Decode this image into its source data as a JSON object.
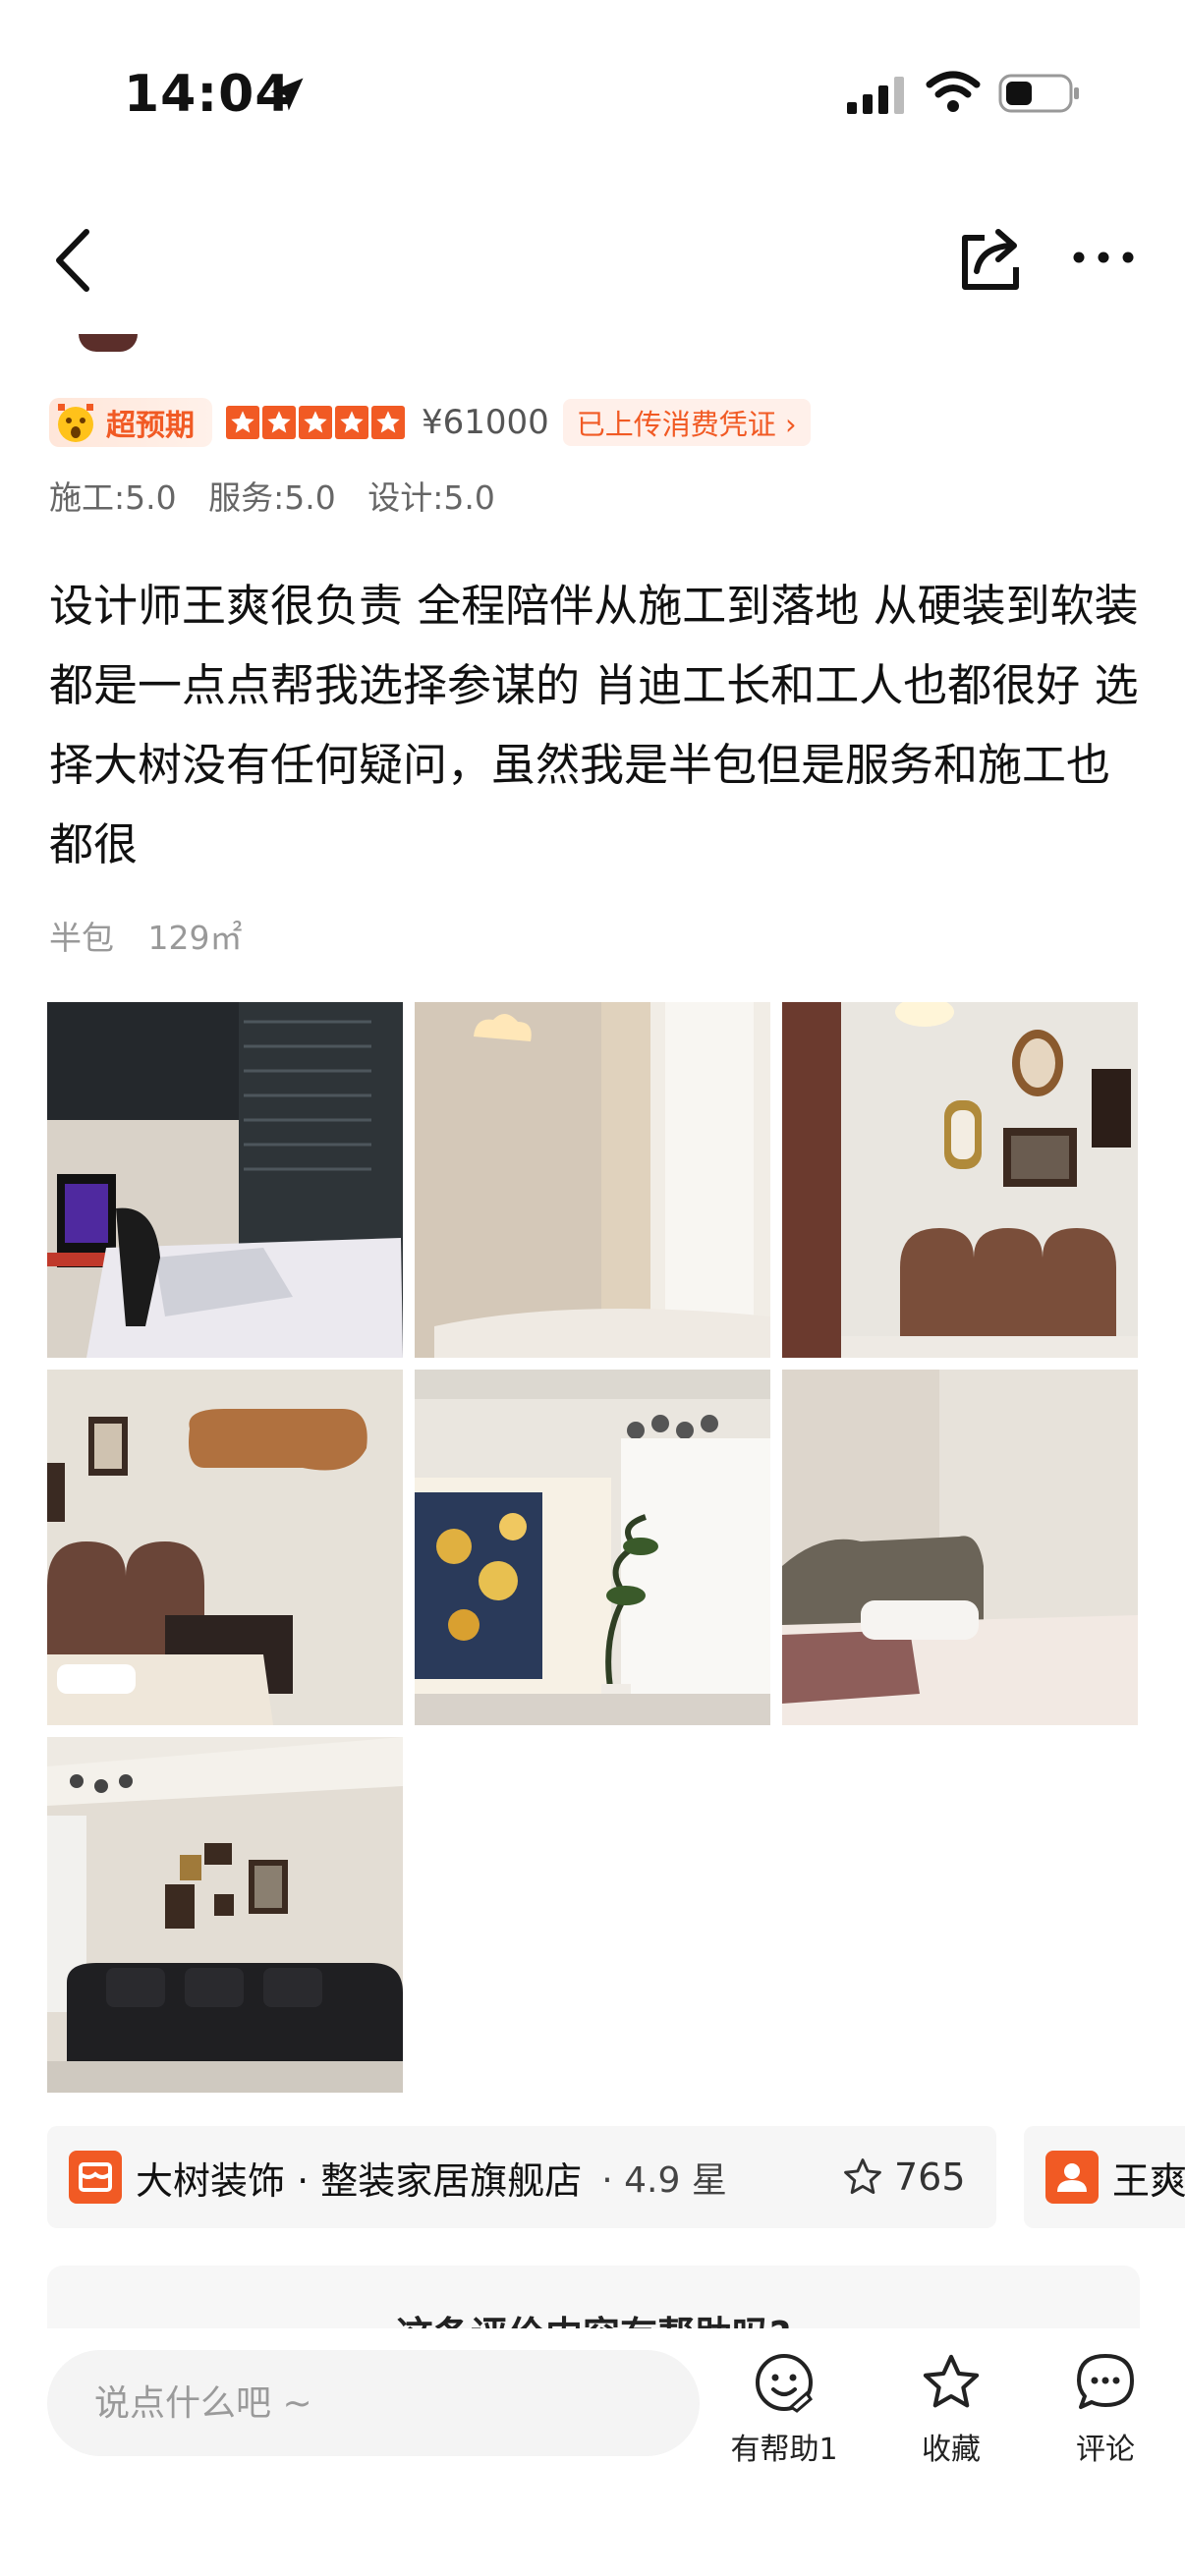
{
  "status_bar": {
    "time": "14:04"
  },
  "review": {
    "badge_label": "超预期",
    "star_count": 5,
    "price": "¥61000",
    "receipt_label": "已上传消费凭证 ›",
    "scores": [
      "施工:5.0",
      "服务:5.0",
      "设计:5.0"
    ],
    "text": "设计师王爽很负责 全程陪伴从施工到落地 从硬装到软装 都是一点点帮我选择参谋的 肖迪工长和工人也都很好 选择大树没有任何疑问，虽然我是半包但是服务和施工也都很",
    "package_type": "半包",
    "area": "129㎡"
  },
  "photos": [
    {
      "name": "photo-study-bedroom"
    },
    {
      "name": "photo-curtain-bedroom"
    },
    {
      "name": "photo-gallery-wall-bedroom"
    },
    {
      "name": "photo-bedroom-desk"
    },
    {
      "name": "photo-living-tv-wall"
    },
    {
      "name": "photo-bedroom-grey-headboard"
    },
    {
      "name": "photo-living-sofa"
    }
  ],
  "shop": {
    "name": "大树装饰 · 整装家居旗舰店",
    "rating": "· 4.9 星",
    "favorites": "765"
  },
  "designer": {
    "name": "王爽"
  },
  "helpful_question": "这条评价内容有帮助吗?",
  "bottom_bar": {
    "comment_placeholder": "说点什么吧 ~",
    "helpful_label": "有帮助1",
    "favorite_label": "收藏",
    "comment_label": "评论"
  },
  "colors": {
    "accent": "#f15a24"
  }
}
